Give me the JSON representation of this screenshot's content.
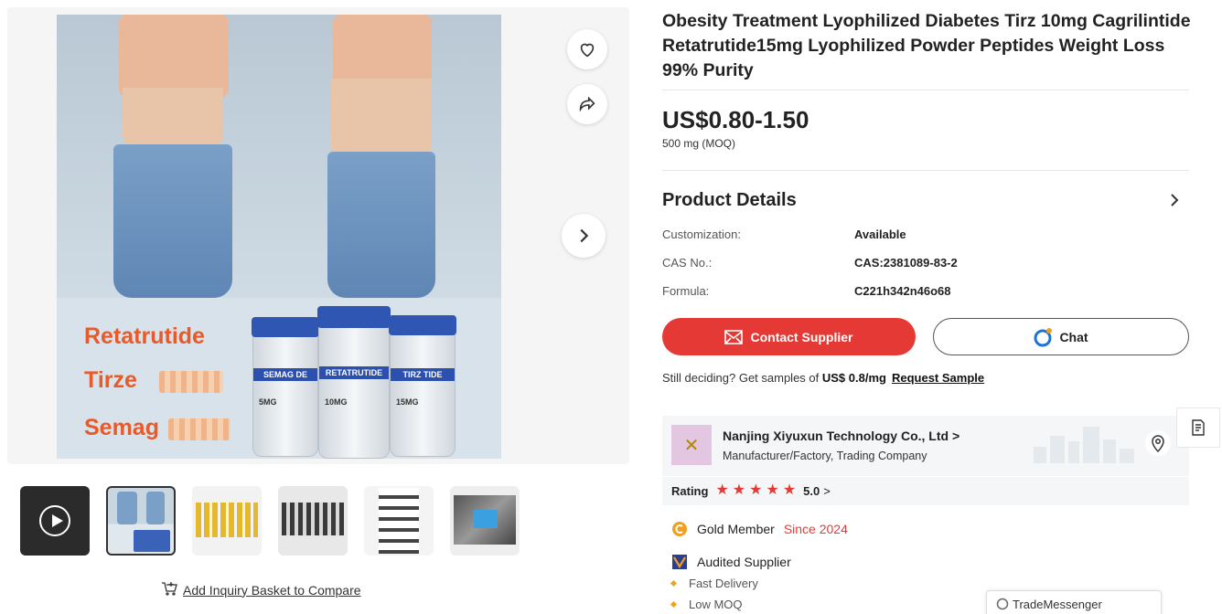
{
  "product": {
    "title": "Obesity Treatment Lyophilized Diabetes Tirz 10mg Cagrilintide Retatrutide15mg Lyophilized Powder Peptides Weight Loss 99% Purity",
    "price": "US$0.80-1.50",
    "moq": "500 mg (MOQ)"
  },
  "image": {
    "brand_lines": [
      "Retatrutide",
      "Tirze",
      "Semag"
    ],
    "vials": [
      {
        "label": "SEMAG     DE",
        "dose": "5MG"
      },
      {
        "label": "RETATRUTIDE",
        "dose": "10MG"
      },
      {
        "label": "TIRZ     TIDE",
        "dose": "15MG"
      }
    ]
  },
  "details": {
    "title": "Product Details",
    "rows": [
      {
        "label": "Customization:",
        "value": "Available"
      },
      {
        "label": "CAS No.:",
        "value": "CAS:2381089-83-2"
      },
      {
        "label": "Formula:",
        "value": "C221h342n46o68"
      }
    ]
  },
  "actions": {
    "contact_label": "Contact Supplier",
    "chat_label": "Chat",
    "sample_prefix": "Still deciding? Get samples of ",
    "sample_price": "US$ 0.8/mg",
    "request_sample": "Request Sample",
    "compare_label": "Add Inquiry Basket to Compare"
  },
  "supplier": {
    "name": "Nanjing Xiyuxun Technology Co., Ltd",
    "name_chevron": ">",
    "type": "Manufacturer/Factory, Trading Company",
    "rating_label": "Rating",
    "rating_value": "5.0",
    "rating_stars": 5,
    "rating_chevron": ">"
  },
  "features": {
    "gold_member": "Gold Member",
    "since": "Since 2024",
    "audited": "Audited Supplier",
    "bullets": [
      "Fast Delivery",
      "Low MOQ"
    ]
  },
  "trade_messenger": "TradeMessenger",
  "colors": {
    "accent_red": "#e53935",
    "bullet_orange": "#f0a020"
  },
  "icons": [
    "heart-icon",
    "share-icon",
    "chevron-right-icon",
    "mail-icon",
    "chat-bubble-icon",
    "location-pin-icon",
    "note-icon",
    "play-icon",
    "basket-icon",
    "gold-member-icon",
    "audited-icon"
  ]
}
